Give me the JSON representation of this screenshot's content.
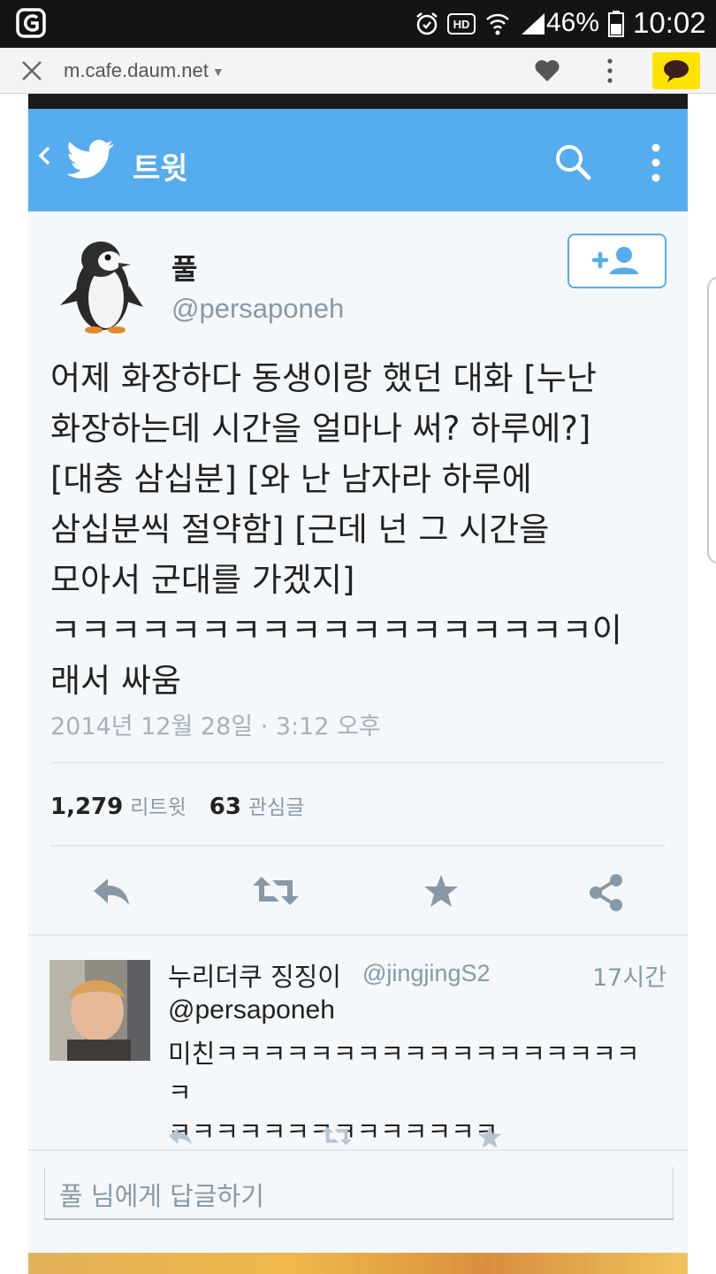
{
  "status_bar": {
    "battery": "46%",
    "time": "10:02"
  },
  "browser": {
    "url": "m.cafe.daum.net"
  },
  "twitter_header": {
    "title": "트윗"
  },
  "tweet": {
    "name": "풀",
    "handle": "@persaponeh",
    "text": "어제 화장하다 동생이랑 했던 대화 [누난 화장하는데 시간을 얼마나 써? 하루에?] [대충 삼십분] [와 난 남자라 하루에 삼십분씩 절약함] [근데 넌 그 시간을 모아서 군대를 가겠지] ㅋㅋㅋㅋㅋㅋㅋㅋㅋㅋㅋㅋㅋㅋㅋㅋㅋㅋ이래서 싸움",
    "lines": [
      "어제 화장하다 동생이랑 했던 대화 [누난",
      "화장하는데 시간을 얼마나 써? 하루에?]",
      "[대충 삼십분] [와 난 남자라 하루에",
      "삼십분씩 절약함] [근데 넌 그 시간을",
      "모아서 군대를 가겠지]",
      "ㅋㅋㅋㅋㅋㅋㅋㅋㅋㅋㅋㅋㅋㅋㅋㅋㅋㅋ이",
      "래서 싸움"
    ],
    "date": "2014년 12월 28일 · 3:12 오후",
    "retweets": "1,279",
    "retweets_label": "리트윗",
    "favorites": "63",
    "favorites_label": "관심글"
  },
  "reply": {
    "name": "누리더쿠 징징이",
    "handle": "@jingjingS2",
    "time": "17시간",
    "mention": "@persaponeh",
    "line1": "미친ㅋㅋㅋㅋㅋㅋㅋㅋㅋㅋㅋㅋㅋㅋㅋㅋㅋㅋㅋ",
    "line2": "ㅋㅋㅋㅋㅋㅋㅋㅋㅋㅋㅋㅋㅋㅋ"
  },
  "compose": {
    "placeholder": "풀 님에게 답글하기"
  },
  "colors": {
    "twitter_blue": "#55acee",
    "kakao_yellow": "#ffe300",
    "muted": "#8899a6"
  },
  "icons": [
    "g-logo-icon",
    "alarm-icon",
    "hd-icon",
    "wifi-icon",
    "signal-icon",
    "battery-icon",
    "close-icon",
    "heart-icon",
    "more-vert-icon",
    "kakaotalk-icon",
    "back-chevron-icon",
    "twitter-bird-icon",
    "search-icon",
    "overflow-menu-icon",
    "follow-user-icon",
    "reply-icon",
    "retweet-icon",
    "favorite-star-icon",
    "share-icon"
  ]
}
